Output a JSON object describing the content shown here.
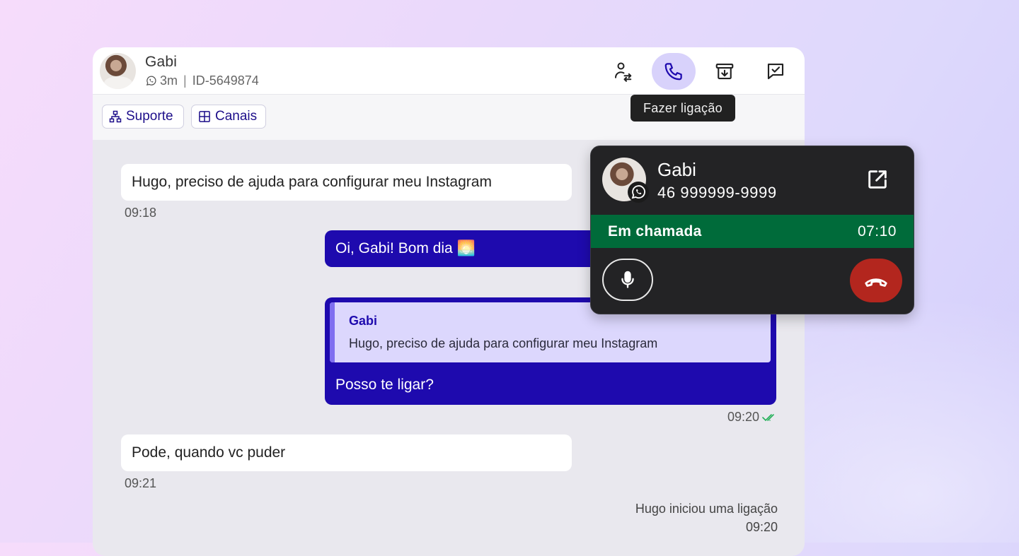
{
  "header": {
    "name": "Gabi",
    "last_seen": "3m",
    "separator": "|",
    "contact_id": "ID-5649874",
    "actions": [
      {
        "icon": "transfer-user-icon"
      },
      {
        "icon": "phone-icon",
        "active": true
      },
      {
        "icon": "archive-icon"
      },
      {
        "icon": "resolve-check-icon"
      }
    ]
  },
  "tags": [
    {
      "label": "Suporte",
      "icon": "sitemap-icon"
    },
    {
      "label": "Canais",
      "icon": "grid-icon"
    }
  ],
  "tooltip": "Fazer ligação",
  "messages": [
    {
      "text": "Hugo, preciso de ajuda para configurar meu Instagram",
      "time": "09:18"
    },
    {
      "text": "Oi, Gabi! Bom dia 🌅"
    },
    {
      "quote_author": "Gabi",
      "quote_text": "Hugo, preciso de ajuda para configurar meu Instagram",
      "text": "Posso te ligar?",
      "time": "09:20"
    },
    {
      "text": "Pode, quando vc puder",
      "time": "09:21"
    },
    {
      "text": "Hugo iniciou uma ligação",
      "time": "09:20"
    }
  ],
  "call": {
    "name": "Gabi",
    "phone": "46 999999-9999",
    "status": "Em chamada",
    "timer": "07:10"
  },
  "colors": {
    "accent": "#1e0aae",
    "quote_bg": "#dcd7fd",
    "call_status_bg": "#006b3a",
    "hangup": "#b3261e",
    "read_ticks": "#25b05a"
  }
}
